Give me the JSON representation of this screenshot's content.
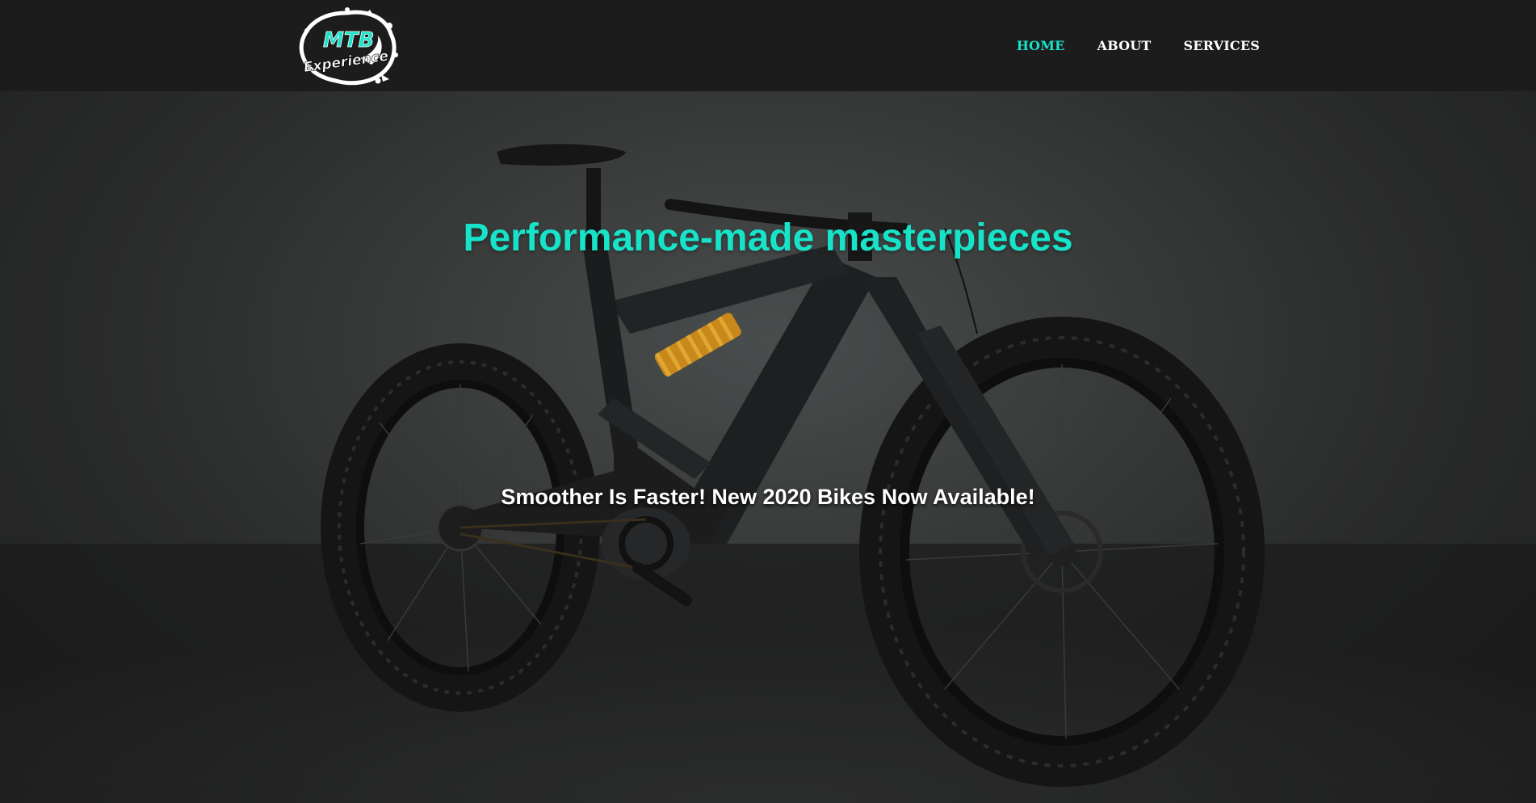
{
  "header": {
    "logo": {
      "line1": "MTB",
      "line2": "Experience"
    },
    "nav": [
      {
        "label": "HOME",
        "active": true
      },
      {
        "label": "ABOUT",
        "active": false
      },
      {
        "label": "SERVICES",
        "active": false
      }
    ]
  },
  "hero": {
    "headline": "Performance-made masterpieces",
    "subheadline": "Smoother Is Faster! New 2020 Bikes Now Available!",
    "image_icon": "mountain-bike-image"
  },
  "colors": {
    "accent": "#17e3c9",
    "navbar": "#1c1c1c",
    "text": "#ffffff",
    "shock_spring": "#d99a1e"
  }
}
